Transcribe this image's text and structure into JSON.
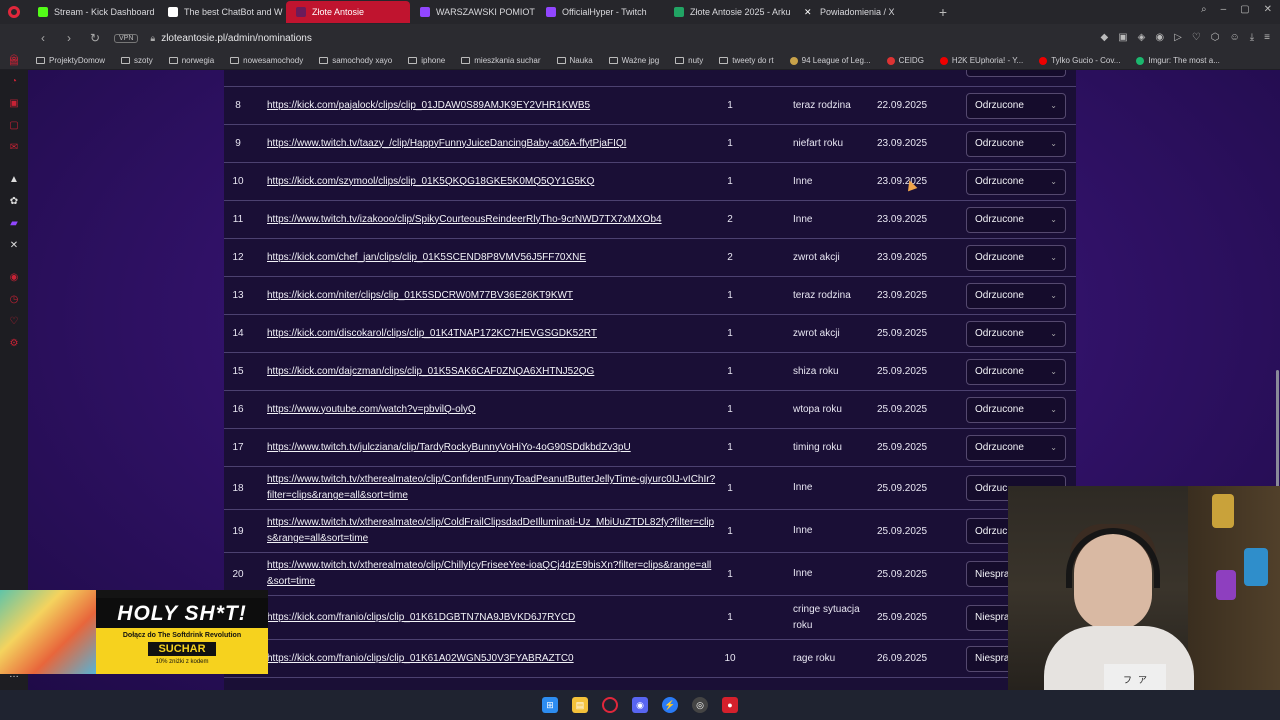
{
  "tabs": [
    {
      "title": "Stream - Kick Dashboard",
      "color": "#53fc18"
    },
    {
      "title": "The best ChatBot and W",
      "color": "#ffffff"
    },
    {
      "title": "Złote Antosie",
      "color": "#6b1b5a",
      "active": true
    },
    {
      "title": "WARSZAWSKI POMIOT",
      "color": "#9146ff"
    },
    {
      "title": "OfficialHyper - Twitch",
      "color": "#9146ff"
    },
    {
      "title": "Złote Antosie 2025 - Arku",
      "color": "#21a464"
    },
    {
      "title": "Powiadomienia / X",
      "color": "#ffffff"
    }
  ],
  "address": {
    "vpn": "VPN",
    "url": "zloteantosie.pl/admin/nominations"
  },
  "bookmarks": [
    {
      "label": "ProjektyDomow",
      "type": "folder"
    },
    {
      "label": "szoty",
      "type": "folder"
    },
    {
      "label": "norwegia",
      "type": "folder"
    },
    {
      "label": "nowesamochody",
      "type": "folder"
    },
    {
      "label": "samochody xayo",
      "type": "folder"
    },
    {
      "label": "iphone",
      "type": "folder"
    },
    {
      "label": "mieszkania suchar",
      "type": "folder"
    },
    {
      "label": "Nauka",
      "type": "folder"
    },
    {
      "label": "Ważne jpg",
      "type": "folder"
    },
    {
      "label": "nuty",
      "type": "folder"
    },
    {
      "label": "tweety do rt",
      "type": "folder"
    },
    {
      "label": "94 League of Leg...",
      "type": "site",
      "color": "#c8a24a"
    },
    {
      "label": "CEIDG",
      "type": "site",
      "color": "#d33"
    },
    {
      "label": "H2K EUphoria! - Y...",
      "type": "site",
      "color": "#e00"
    },
    {
      "label": "Tylko Gucio - Cov...",
      "type": "site",
      "color": "#e00"
    },
    {
      "label": "Imgur: The most a...",
      "type": "site",
      "color": "#1bb76e"
    }
  ],
  "nominations": [
    {
      "num": "8",
      "link": "https://kick.com/pajalock/clips/clip_01JDAW0S89AMJK9EY2VHR1KWB5",
      "count": "1",
      "category": "teraz rodzina",
      "date": "22.09.2025",
      "status": "Odrzucone"
    },
    {
      "num": "9",
      "link": "https://www.twitch.tv/taazy_/clip/HappyFunnyJuiceDancingBaby-a06A-ffytPjaFIQI",
      "count": "1",
      "category": "niefart roku",
      "date": "23.09.2025",
      "status": "Odrzucone"
    },
    {
      "num": "10",
      "link": "https://kick.com/szymool/clips/clip_01K5QKQG18GKE5K0MQ5QY1G5KQ",
      "count": "1",
      "category": "Inne",
      "date": "23.09.2025",
      "status": "Odrzucone"
    },
    {
      "num": "11",
      "link": "https://www.twitch.tv/izakooo/clip/SpikyCourteousReindeerRlyTho-9crNWD7TX7xMXOb4",
      "count": "2",
      "category": "Inne",
      "date": "23.09.2025",
      "status": "Odrzucone"
    },
    {
      "num": "12",
      "link": "https://kick.com/chef_jan/clips/clip_01K5SCEND8P8VMV56J5FF70XNE",
      "count": "2",
      "category": "zwrot akcji",
      "date": "23.09.2025",
      "status": "Odrzucone"
    },
    {
      "num": "13",
      "link": "https://kick.com/niter/clips/clip_01K5SDCRW0M77BV36E26KT9KWT",
      "count": "1",
      "category": "teraz rodzina",
      "date": "23.09.2025",
      "status": "Odrzucone"
    },
    {
      "num": "14",
      "link": "https://kick.com/discokarol/clips/clip_01K4TNAP172KC7HEVGSGDK52RT",
      "count": "1",
      "category": "zwrot akcji",
      "date": "25.09.2025",
      "status": "Odrzucone"
    },
    {
      "num": "15",
      "link": "https://kick.com/dajczman/clips/clip_01K5SAK6CAF0ZNQA6XHTNJ52QG",
      "count": "1",
      "category": "shiza roku",
      "date": "25.09.2025",
      "status": "Odrzucone"
    },
    {
      "num": "16",
      "link": "https://www.youtube.com/watch?v=pbvilQ-olyQ",
      "count": "1",
      "category": "wtopa roku",
      "date": "25.09.2025",
      "status": "Odrzucone"
    },
    {
      "num": "17",
      "link": "https://www.twitch.tv/julcziana/clip/TardyRockyBunnyVoHiYo-4oG90SDdkbdZv3pU",
      "count": "1",
      "category": "timing roku",
      "date": "25.09.2025",
      "status": "Odrzucone"
    },
    {
      "num": "18",
      "link": "https://www.twitch.tv/xtherealmateo/clip/ConfidentFunnyToadPeanutButterJellyTime-gjyurc0IJ-vIChIr?filter=clips&range=all&sort=time",
      "count": "1",
      "category": "Inne",
      "date": "25.09.2025",
      "status": "Odrzuc"
    },
    {
      "num": "19",
      "link": "https://www.twitch.tv/xtherealmateo/clip/ColdFrailClipsdadDeIlluminati-Uz_MbiUuZTDL82fy?filter=clips&range=all&sort=time",
      "count": "1",
      "category": "Inne",
      "date": "25.09.2025",
      "status": "Odrzuc"
    },
    {
      "num": "20",
      "link": "https://www.twitch.tv/xtherealmateo/clip/ChillyIcyFriseeYee-ioaQCj4dzE9bisXn?filter=clips&range=all&sort=time",
      "count": "1",
      "category": "Inne",
      "date": "25.09.2025",
      "status": "Niespra"
    },
    {
      "num": "",
      "link": "https://kick.com/franio/clips/clip_01K61DGBTN7NA9JBVKD6J7RYCD",
      "count": "1",
      "category": "cringe sytuacja roku",
      "date": "25.09.2025",
      "status": "Niespra"
    },
    {
      "num": "",
      "link": "https://kick.com/franio/clips/clip_01K61A02WGN5J0V3FYABRAZTC0",
      "count": "10",
      "category": "rage roku",
      "date": "26.09.2025",
      "status": "Niespra"
    }
  ],
  "ad": {
    "title": "HOLY SH*T!",
    "line1": "Dołącz do The Softdrink Revolution",
    "logo": "SUCHAR",
    "line3": "10% zniżki z kodem"
  },
  "webcam_poster": [
    "フ",
    "ア"
  ]
}
